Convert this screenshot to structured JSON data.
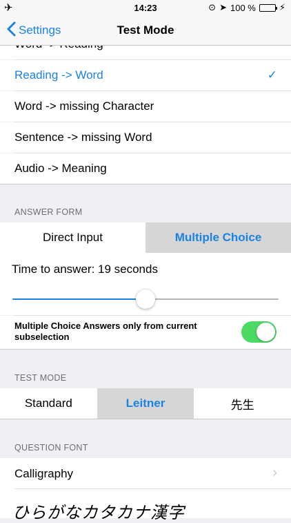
{
  "status": {
    "time": "14:23",
    "battery_text": "100 %"
  },
  "nav": {
    "back_label": "Settings",
    "title": "Test Mode"
  },
  "quiz_types": [
    {
      "label": "Word -> Reading",
      "selected": false
    },
    {
      "label": "Reading -> Word",
      "selected": true
    },
    {
      "label": "Word -> missing Character",
      "selected": false
    },
    {
      "label": "Sentence -> missing Word",
      "selected": false
    },
    {
      "label": "Audio -> Meaning",
      "selected": false
    }
  ],
  "answer_form": {
    "header": "ANSWER FORM",
    "options": [
      "Direct Input",
      "Multiple Choice"
    ],
    "selected": "Multiple Choice",
    "time_label": "Time to answer: 19 seconds",
    "slider_fraction": 0.5,
    "toggle_label_line1": "Multiple Choice Answers only from current",
    "toggle_label_line2": "subselection",
    "toggle_on": true
  },
  "test_mode": {
    "header": "TEST MODE",
    "options": [
      "Standard",
      "Leitner",
      "先生"
    ],
    "selected": "Leitner"
  },
  "question_font": {
    "header": "QUESTION FONT",
    "value": "Calligraphy",
    "preview": "ひらがなカタカナ漢字"
  },
  "colors": {
    "accent": "#1a82e2",
    "toggle_on": "#4cd964",
    "selected_segment": "#d6d6d6"
  }
}
